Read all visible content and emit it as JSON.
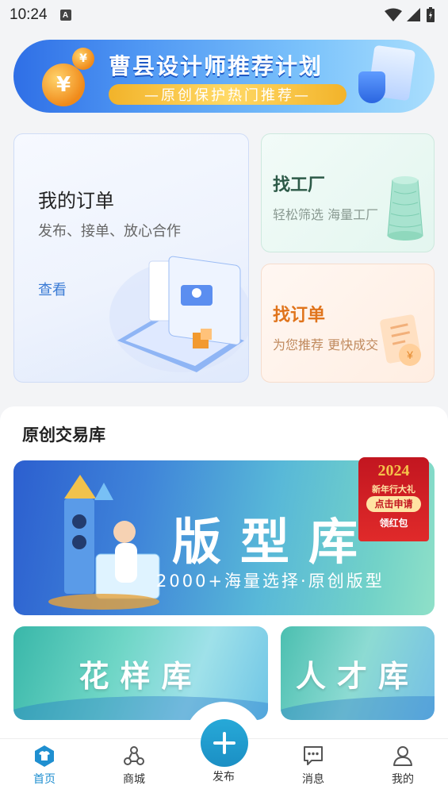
{
  "status_bar": {
    "time": "10:24",
    "indicator": "A"
  },
  "banner": {
    "title": "曹县设计师推荐计划",
    "subtitle": "—原创保护热门推荐—"
  },
  "cards": {
    "my_orders": {
      "title": "我的订单",
      "desc": "发布、接单、放心合作",
      "link": "查看"
    },
    "find_factory": {
      "title": "找工厂",
      "desc": "轻松筛选 海量工厂"
    },
    "find_orders": {
      "title": "找订单",
      "desc": "为您推荐 更快成交"
    }
  },
  "library": {
    "section_title": "原创交易库",
    "pattern": {
      "title": "版型库",
      "subtitle": "2000+海量选择·原创版型"
    },
    "promo": {
      "year": "2024",
      "line1": "新年行大礼",
      "line2": "点击申请",
      "line3": "领红包"
    },
    "flower": {
      "title": "花样库"
    },
    "talent": {
      "title": "人才库"
    }
  },
  "nav": {
    "home": "首页",
    "mall": "商城",
    "publish": "发布",
    "messages": "消息",
    "mine": "我的"
  },
  "colors": {
    "accent": "#1f8fd0",
    "order_accent": "#e0741c",
    "factory_accent": "#2d5a48"
  }
}
